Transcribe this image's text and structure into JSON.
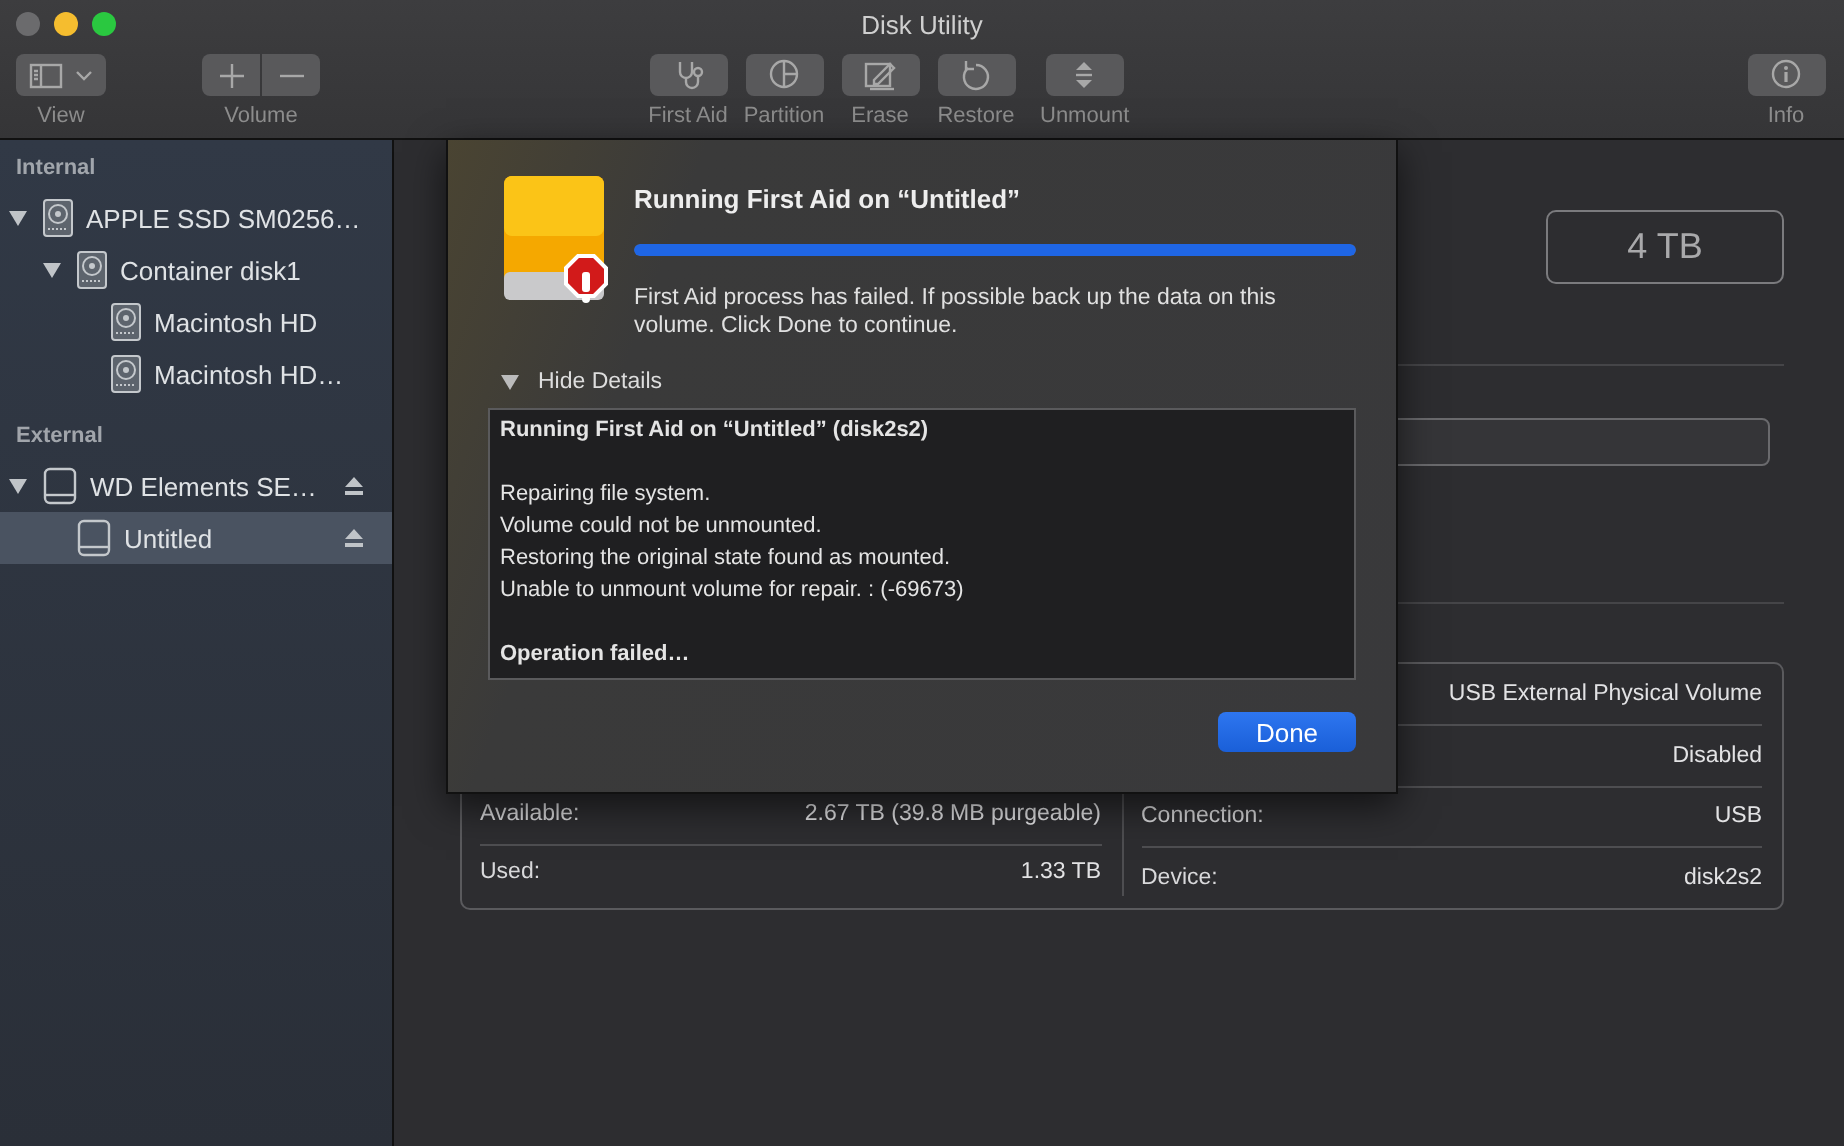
{
  "window": {
    "title": "Disk Utility"
  },
  "toolbar": {
    "left": [
      {
        "kind": "view",
        "label": "View"
      },
      {
        "kind": "volume",
        "label": "Volume"
      }
    ],
    "center": [
      {
        "kind": "first-aid",
        "label": "First Aid"
      },
      {
        "kind": "partition",
        "label": "Partition"
      },
      {
        "kind": "erase",
        "label": "Erase"
      },
      {
        "kind": "restore",
        "label": "Restore"
      },
      {
        "kind": "unmount",
        "label": "Unmount"
      }
    ],
    "right": [
      {
        "kind": "info",
        "label": "Info"
      }
    ]
  },
  "sidebar": {
    "sections": [
      {
        "title": "Internal",
        "items": [
          {
            "label": "APPLE SSD SM0256…",
            "kind": "internal",
            "expanded": true,
            "selected": false,
            "children": [
              {
                "label": "Container disk1",
                "kind": "internal",
                "expanded": true,
                "selected": false,
                "children": [
                  {
                    "label": "Macintosh HD",
                    "kind": "internal",
                    "selected": false
                  },
                  {
                    "label": "Macintosh HD…",
                    "kind": "internal",
                    "selected": false
                  }
                ]
              }
            ]
          }
        ]
      },
      {
        "title": "External",
        "items": [
          {
            "label": "WD Elements SE…",
            "kind": "external",
            "expanded": true,
            "selected": false,
            "eject": true,
            "children": [
              {
                "label": "Untitled",
                "kind": "external",
                "selected": true,
                "eject": true
              }
            ]
          }
        ]
      }
    ]
  },
  "main": {
    "capacity": "4 TB",
    "info_left": [
      {
        "label": "Available:",
        "value": "2.67 TB (39.8 MB purgeable)"
      },
      {
        "label": "Used:",
        "value": "1.33 TB"
      }
    ],
    "info_right": [
      {
        "value": "USB External Physical Volume"
      },
      {
        "value": "Disabled"
      },
      {
        "label": "Connection:",
        "value": "USB"
      },
      {
        "label": "Device:",
        "value": "disk2s2"
      }
    ]
  },
  "dialog": {
    "title": "Running First Aid on “Untitled”",
    "progress": {
      "level": 1
    },
    "message": "First Aid process has failed. If possible back up the data on this volume. Click Done to continue.",
    "details": {
      "toggle_label": "Hide Details",
      "expanded": true,
      "log": [
        {
          "kind": "heading",
          "lines": [
            "Running First Aid on “Untitled” (disk2s2)"
          ]
        },
        {
          "kind": "body",
          "lines": [
            "Repairing file system.",
            "Volume could not be unmounted.",
            "Restoring the original state found as mounted.",
            "Unable to unmount volume for repair. : (-69673)"
          ]
        },
        {
          "kind": "heading",
          "lines": [
            "Operation failed…"
          ]
        }
      ]
    },
    "buttons": [
      {
        "kind": "default",
        "label": "Done"
      }
    ]
  }
}
